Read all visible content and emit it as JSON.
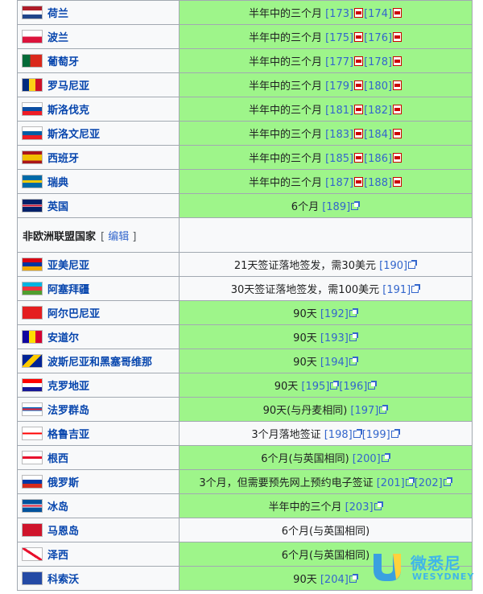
{
  "rows_eu": [
    {
      "country": "荷兰",
      "flag": "netherlands-flag",
      "requirement": "半年中的三个月",
      "refs": [
        "[173]",
        "[174]"
      ],
      "ref_icon": "pdf",
      "bg": "green"
    },
    {
      "country": "波兰",
      "flag": "poland-flag",
      "requirement": "半年中的三个月",
      "refs": [
        "[175]",
        "[176]"
      ],
      "ref_icon": "pdf",
      "bg": "green"
    },
    {
      "country": "葡萄牙",
      "flag": "portugal-flag",
      "requirement": "半年中的三个月",
      "refs": [
        "[177]",
        "[178]"
      ],
      "ref_icon": "pdf",
      "bg": "green"
    },
    {
      "country": "罗马尼亚",
      "flag": "romania-flag",
      "requirement": "半年中的三个月",
      "refs": [
        "[179]",
        "[180]"
      ],
      "ref_icon": "pdf",
      "bg": "green"
    },
    {
      "country": "斯洛伐克",
      "flag": "slovakia-flag",
      "requirement": "半年中的三个月",
      "refs": [
        "[181]",
        "[182]"
      ],
      "ref_icon": "pdf",
      "bg": "green"
    },
    {
      "country": "斯洛文尼亚",
      "flag": "slovenia-flag",
      "requirement": "半年中的三个月",
      "refs": [
        "[183]",
        "[184]"
      ],
      "ref_icon": "pdf",
      "bg": "green"
    },
    {
      "country": "西班牙",
      "flag": "spain-flag",
      "requirement": "半年中的三个月",
      "refs": [
        "[185]",
        "[186]"
      ],
      "ref_icon": "pdf",
      "bg": "green"
    },
    {
      "country": "瑞典",
      "flag": "sweden-flag",
      "requirement": "半年中的三个月",
      "refs": [
        "[187]",
        "[188]"
      ],
      "ref_icon": "pdf",
      "bg": "green"
    },
    {
      "country": "英国",
      "flag": "uk-flag",
      "requirement": "6个月",
      "refs": [
        "[189]"
      ],
      "ref_icon": "ext",
      "bg": "green"
    }
  ],
  "section": {
    "title": "非欧洲联盟国家",
    "edit_open": "[",
    "edit_label": "编辑",
    "edit_close": "]"
  },
  "rows_non_eu": [
    {
      "country": "亚美尼亚",
      "flag": "armenia-flag",
      "requirement": "21天签证落地签发，需30美元",
      "refs": [
        "[190]"
      ],
      "ref_icon": "ext",
      "bg": "white"
    },
    {
      "country": "阿塞拜疆",
      "flag": "azerbaijan-flag",
      "requirement": "30天签证落地签发，需100美元",
      "refs": [
        "[191]"
      ],
      "ref_icon": "ext",
      "bg": "white"
    },
    {
      "country": "阿尔巴尼亚",
      "flag": "albania-flag",
      "requirement": "90天",
      "refs": [
        "[192]"
      ],
      "ref_icon": "ext",
      "bg": "green"
    },
    {
      "country": "安道尔",
      "flag": "andorra-flag",
      "requirement": "90天",
      "refs": [
        "[193]"
      ],
      "ref_icon": "ext",
      "bg": "green"
    },
    {
      "country": "波斯尼亚和黑塞哥维那",
      "flag": "bosnia-flag",
      "requirement": "90天",
      "refs": [
        "[194]"
      ],
      "ref_icon": "ext",
      "bg": "green"
    },
    {
      "country": "克罗地亚",
      "flag": "croatia-flag",
      "requirement": "90天",
      "refs": [
        "[195]",
        "[196]"
      ],
      "ref_icon": "ext",
      "bg": "green"
    },
    {
      "country": "法罗群岛",
      "flag": "faroe-flag",
      "requirement": "90天(与丹麦相同)",
      "refs": [
        "[197]"
      ],
      "ref_icon": "ext",
      "bg": "green"
    },
    {
      "country": "格鲁吉亚",
      "flag": "georgia-flag",
      "requirement": "3个月落地签证",
      "refs": [
        "[198]",
        "[199]"
      ],
      "ref_icon": "ext",
      "bg": "white"
    },
    {
      "country": "根西",
      "flag": "guernsey-flag",
      "requirement": "6个月(与英国相同)",
      "refs": [
        "[200]"
      ],
      "ref_icon": "ext",
      "bg": "green"
    },
    {
      "country": "俄罗斯",
      "flag": "russia-flag",
      "requirement": "3个月，但需要预先网上预约电子签证",
      "refs": [
        "[201]",
        "[202]"
      ],
      "ref_icon": "ext",
      "bg": "green"
    },
    {
      "country": "冰岛",
      "flag": "iceland-flag",
      "requirement": "半年中的三个月",
      "refs": [
        "[203]"
      ],
      "ref_icon": "ext",
      "bg": "green"
    },
    {
      "country": "马恩岛",
      "flag": "isle-of-man-flag",
      "requirement": "6个月(与英国相同)",
      "refs": [],
      "ref_icon": "none",
      "bg": "white"
    },
    {
      "country": "泽西",
      "flag": "jersey-flag",
      "requirement": "6个月(与英国相同)",
      "refs": [],
      "ref_icon": "none",
      "bg": "green"
    },
    {
      "country": "科索沃",
      "flag": "kosovo-flag",
      "requirement": "90天",
      "refs": [
        "[204]"
      ],
      "ref_icon": "ext",
      "bg": "green"
    }
  ],
  "watermark": {
    "brand_cn": "微悉尼",
    "brand_en": "WESYDNEY"
  }
}
